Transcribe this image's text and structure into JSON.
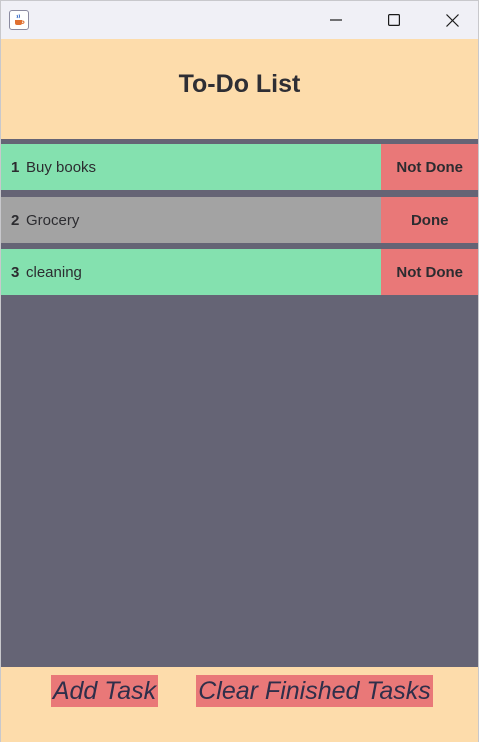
{
  "window": {
    "app_icon": "java-cup-icon",
    "controls": [
      "minimize-icon",
      "maximize-icon",
      "close-icon"
    ]
  },
  "header": {
    "title": "To-Do List"
  },
  "tasks": [
    {
      "number": "1",
      "name": "Buy books",
      "status": "Not Done",
      "row_color": "#84e1af"
    },
    {
      "number": "2",
      "name": "Grocery",
      "status": "Done",
      "row_color": "#a3a3a3"
    },
    {
      "number": "3",
      "name": "cleaning",
      "status": "Not Done",
      "row_color": "#84e1af"
    }
  ],
  "footer": {
    "add_label": "Add Task",
    "clear_label": "Clear Finished Tasks"
  },
  "colors": {
    "header_bg": "#fddcab",
    "list_bg": "#656475",
    "status_bg": "#e97878",
    "pending_row": "#84e1af",
    "done_row": "#a3a3a3"
  }
}
